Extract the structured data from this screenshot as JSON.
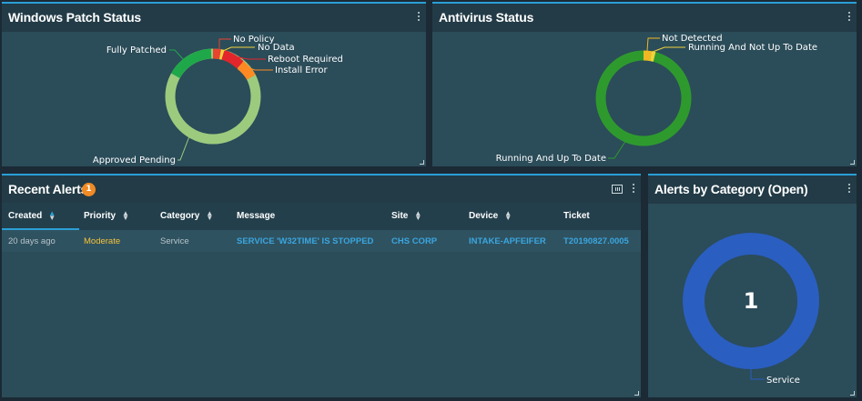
{
  "patch": {
    "title": "Windows Patch Status",
    "labels": {
      "no_policy": "No Policy",
      "no_data": "No Data",
      "reboot_required": "Reboot Required",
      "install_error": "Install Error",
      "fully_patched": "Fully Patched",
      "approved_pending": "Approved Pending"
    },
    "colors": {
      "approved_pending": "#9ccb7e",
      "fully_patched": "#1fa84a",
      "no_policy": "#e8452f",
      "no_data": "#f2d23b",
      "reboot_required": "#e3262b",
      "install_error": "#ff8a24"
    }
  },
  "antivirus": {
    "title": "Antivirus Status",
    "labels": {
      "not_detected": "Not Detected",
      "running_not_up_to_date": "Running And Not Up To Date",
      "running_up_to_date": "Running And Up To Date"
    },
    "colors": {
      "running_up_to_date": "#2e9a2e",
      "not_detected": "#f2b824",
      "running_not_up_to_date": "#f2d23b"
    }
  },
  "alerts": {
    "title": "Recent Alerts",
    "badge": "1",
    "columns": {
      "created": "Created",
      "priority": "Priority",
      "category": "Category",
      "message": "Message",
      "site": "Site",
      "device": "Device",
      "ticket": "Ticket"
    },
    "rows": [
      {
        "created": "20 days ago",
        "priority": "Moderate",
        "category": "Service",
        "message": "SERVICE 'W32TIME' IS STOPPED",
        "site": "CHS CORP",
        "device": "INTAKE-APFEIFER",
        "ticket": "T20190827.0005"
      }
    ]
  },
  "category": {
    "title": "Alerts by Category (Open)",
    "total": "1",
    "label": "Service",
    "color": "#2a5ec0"
  }
}
